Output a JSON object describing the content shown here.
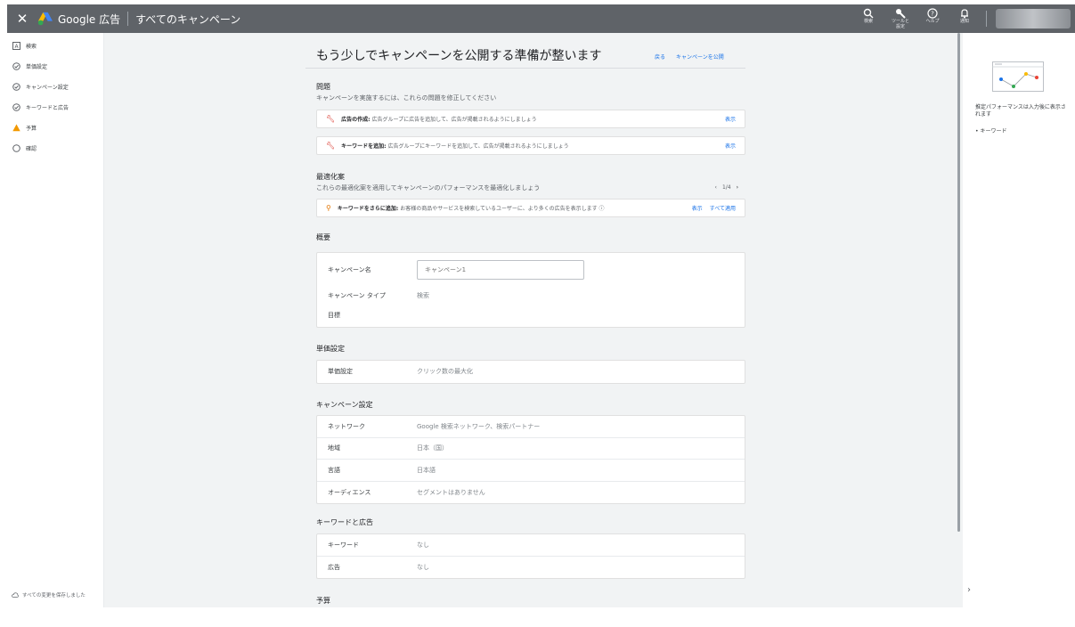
{
  "topbar": {
    "brand": "Google 広告",
    "breadcrumb": "すべてのキャンペーン",
    "tools": [
      {
        "icon": "search-icon",
        "label": "検索"
      },
      {
        "icon": "wrench-icon",
        "label": "ツールと設定"
      },
      {
        "icon": "help-icon",
        "label": "ヘルプ"
      },
      {
        "icon": "bell-icon",
        "label": "通知"
      }
    ]
  },
  "sidebar": {
    "items": [
      {
        "label": "検索",
        "icon": "ads-icon"
      },
      {
        "label": "単価設定",
        "icon": "check-circle-icon"
      },
      {
        "label": "キャンペーン設定",
        "icon": "check-circle-icon"
      },
      {
        "label": "キーワードと広告",
        "icon": "check-circle-icon"
      },
      {
        "label": "予算",
        "icon": "warning-icon"
      },
      {
        "label": "確認",
        "icon": "empty-circle-icon"
      }
    ],
    "saved_text": "すべての変更を保存しました"
  },
  "header": {
    "title": "もう少しでキャンペーンを公開する準備が整います",
    "back_label": "戻る",
    "publish_label": "キャンペーンを公開"
  },
  "issues": {
    "title": "問題",
    "subtitle": "キャンペーンを実施するには、これらの問題を修正してください",
    "items": [
      {
        "bold": "広告の作成:",
        "text": "広告グループに広告を追加して、広告が掲載されるようにしましょう",
        "link": "表示"
      },
      {
        "bold": "キーワードを追加:",
        "text": "広告グループにキーワードを追加して、広告が掲載されるようにしましょう",
        "link": "表示"
      }
    ]
  },
  "optimization": {
    "title": "最適化案",
    "subtitle": "これらの最適化案を適用してキャンペーンのパフォーマンスを最適化しましょう",
    "pager": "1/4",
    "item": {
      "bold": "キーワードをさらに追加:",
      "text": "お客様の商品やサービスを検索しているユーザーに、より多くの広告を表示します",
      "link_view": "表示",
      "link_apply": "すべて適用"
    }
  },
  "overview": {
    "title": "概要",
    "name_label": "キャンペーン名",
    "name_placeholder": "キャンペーン1",
    "type_label": "キャンペーン タイプ",
    "type_value": "検索",
    "goal_label": "目標"
  },
  "bidding": {
    "title": "単価設定",
    "label": "単価設定",
    "value": "クリック数の最大化"
  },
  "campaign_settings": {
    "title": "キャンペーン設定",
    "rows": [
      {
        "label": "ネットワーク",
        "value": "Google 検索ネットワーク、検索パートナー"
      },
      {
        "label": "地域",
        "value": "日本（国）"
      },
      {
        "label": "言語",
        "value": "日本語"
      },
      {
        "label": "オーディエンス",
        "value": "セグメントはありません"
      }
    ]
  },
  "keywords_ads": {
    "title": "キーワードと広告",
    "rows": [
      {
        "label": "キーワード",
        "value": "なし"
      },
      {
        "label": "広告",
        "value": "なし"
      }
    ]
  },
  "budget": {
    "title": "予算"
  },
  "rightpane": {
    "text": "推定パフォーマンスは入力後に表示されます",
    "bullet": "キーワード"
  }
}
